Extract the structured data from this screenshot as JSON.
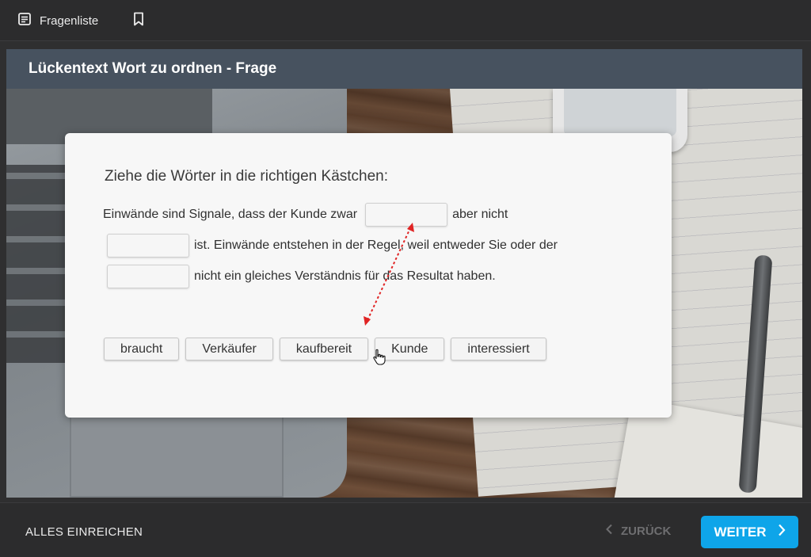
{
  "topbar": {
    "question_list_label": "Fragenliste",
    "question_list_icon": "list-icon",
    "bookmark_icon": "bookmark-icon"
  },
  "question": {
    "title": "Lückentext Wort zu ordnen - Frage",
    "instruction": "Ziehe die Wörter in die richtigen Kästchen:",
    "line1_text_before": "Einwände sind Signale, dass der Kunde zwar",
    "line1_text_after": "aber nicht",
    "line2_text_after": "ist. Einwände entstehen in der Regel, weil entweder Sie oder der",
    "line3_text_after": "nicht ein gleiches Verständnis für das Resultat haben.",
    "word_bank": [
      "braucht",
      "Verkäufer",
      "kaufbereit",
      "Kunde",
      "interessiert"
    ]
  },
  "bottombar": {
    "submit_all_label": "ALLES EINREICHEN",
    "back_label": "ZURÜCK",
    "next_label": "WEITER"
  },
  "colors": {
    "header_bg": "#47525f",
    "next_button": "#0ea5e9",
    "drag_arrow": "#e02424"
  }
}
